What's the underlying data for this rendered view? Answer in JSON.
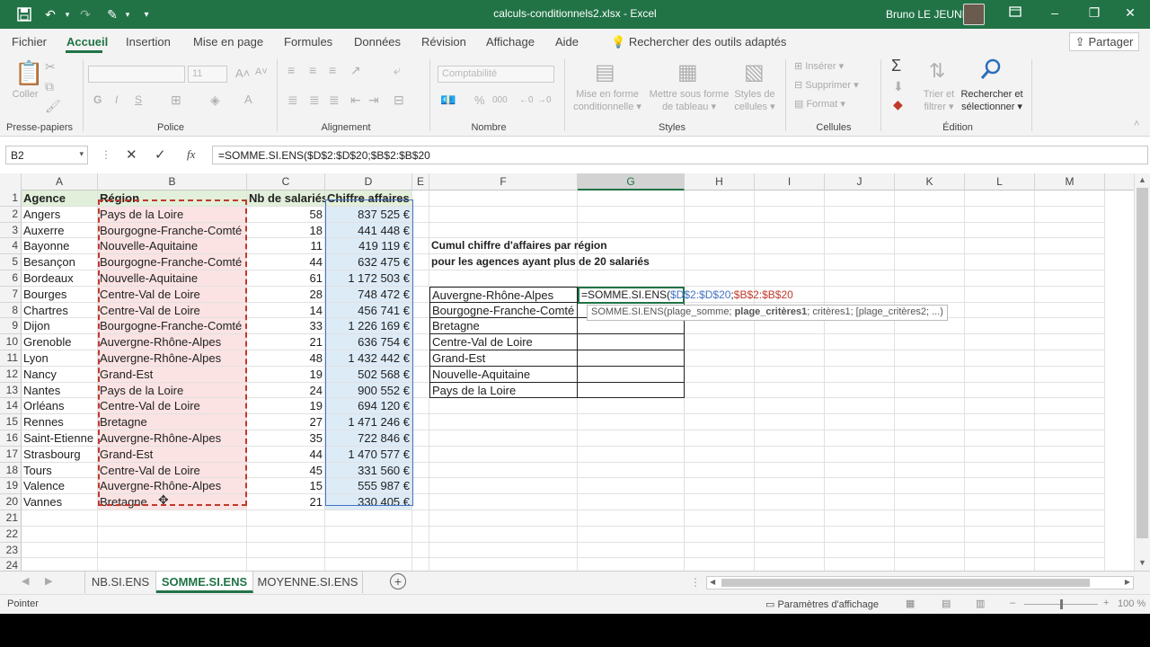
{
  "title": {
    "document": "calculs-conditionnels2.xlsx  -  Excel",
    "user": "Bruno LE JEUNE"
  },
  "tabs": [
    "Fichier",
    "Accueil",
    "Insertion",
    "Mise en page",
    "Formules",
    "Données",
    "Révision",
    "Affichage",
    "Aide"
  ],
  "tell_me": "Rechercher des outils adaptés",
  "share": "Partager",
  "ribbon": {
    "clipboard": {
      "paste": "Coller",
      "group": "Presse-papiers"
    },
    "font": {
      "group": "Police",
      "size": "11"
    },
    "alignment": {
      "group": "Alignement"
    },
    "number": {
      "group": "Nombre",
      "format": "Comptabilité",
      "percent": "%",
      "thousands": "000"
    },
    "styles": {
      "group": "Styles",
      "cond1": "Mise en forme",
      "cond2": "conditionnelle",
      "table1": "Mettre sous forme",
      "table2": "de tableau",
      "cell1": "Styles de",
      "cell2": "cellules"
    },
    "cells": {
      "group": "Cellules",
      "insert": "Insérer",
      "delete": "Supprimer",
      "format": "Format"
    },
    "editing": {
      "group": "Édition",
      "sort1": "Trier et",
      "sort2": "filtrer",
      "find1": "Rechercher et",
      "find2": "sélectionner"
    }
  },
  "formula_bar": {
    "name_box": "B2",
    "formula": "=SOMME.SI.ENS($D$2:$D$20;$B$2:$B$20"
  },
  "columns": [
    "A",
    "B",
    "C",
    "D",
    "E",
    "F",
    "G",
    "H",
    "I",
    "J",
    "K",
    "L",
    "M"
  ],
  "headers": {
    "a": "Agence",
    "b": "Région",
    "c": "Nb de salariés",
    "d": "Chiffre affaires"
  },
  "rows": [
    {
      "n": "1"
    },
    {
      "n": "2",
      "a": "Angers",
      "b": "Pays de la Loire",
      "c": "58",
      "d": "837 525 €"
    },
    {
      "n": "3",
      "a": "Auxerre",
      "b": "Bourgogne-Franche-Comté",
      "c": "18",
      "d": "441 448 €"
    },
    {
      "n": "4",
      "a": "Bayonne",
      "b": "Nouvelle-Aquitaine",
      "c": "11",
      "d": "419 119 €"
    },
    {
      "n": "5",
      "a": "Besançon",
      "b": "Bourgogne-Franche-Comté",
      "c": "44",
      "d": "632 475 €"
    },
    {
      "n": "6",
      "a": "Bordeaux",
      "b": "Nouvelle-Aquitaine",
      "c": "61",
      "d": "1 172 503 €"
    },
    {
      "n": "7",
      "a": "Bourges",
      "b": "Centre-Val de Loire",
      "c": "28",
      "d": "748 472 €"
    },
    {
      "n": "8",
      "a": "Chartres",
      "b": "Centre-Val de Loire",
      "c": "14",
      "d": "456 741 €"
    },
    {
      "n": "9",
      "a": "Dijon",
      "b": "Bourgogne-Franche-Comté",
      "c": "33",
      "d": "1 226 169 €"
    },
    {
      "n": "10",
      "a": "Grenoble",
      "b": "Auvergne-Rhône-Alpes",
      "c": "21",
      "d": "636 754 €"
    },
    {
      "n": "11",
      "a": "Lyon",
      "b": "Auvergne-Rhône-Alpes",
      "c": "48",
      "d": "1 432 442 €"
    },
    {
      "n": "12",
      "a": "Nancy",
      "b": "Grand-Est",
      "c": "19",
      "d": "502 568 €"
    },
    {
      "n": "13",
      "a": "Nantes",
      "b": "Pays de la Loire",
      "c": "24",
      "d": "900 552 €"
    },
    {
      "n": "14",
      "a": "Orléans",
      "b": "Centre-Val de Loire",
      "c": "19",
      "d": "694 120 €"
    },
    {
      "n": "15",
      "a": "Rennes",
      "b": "Bretagne",
      "c": "27",
      "d": "1 471 246 €"
    },
    {
      "n": "16",
      "a": "Saint-Etienne",
      "b": "Auvergne-Rhône-Alpes",
      "c": "35",
      "d": "722 846 €"
    },
    {
      "n": "17",
      "a": "Strasbourg",
      "b": "Grand-Est",
      "c": "44",
      "d": "1 470 577 €"
    },
    {
      "n": "18",
      "a": "Tours",
      "b": "Centre-Val de Loire",
      "c": "45",
      "d": "331 560 €"
    },
    {
      "n": "19",
      "a": "Valence",
      "b": "Auvergne-Rhône-Alpes",
      "c": "15",
      "d": "555 987 €"
    },
    {
      "n": "20",
      "a": "Vannes",
      "b": "Bretagne",
      "c": "21",
      "d": "330 405 €"
    },
    {
      "n": "21"
    },
    {
      "n": "22"
    },
    {
      "n": "23"
    },
    {
      "n": "24"
    }
  ],
  "summary": {
    "title1": "Cumul chiffre d'affaires par région",
    "title2": "pour les agences ayant plus de 20 salariés",
    "regions": [
      "Auvergne-Rhône-Alpes",
      "Bourgogne-Franche-Comté",
      "Bretagne",
      "Centre-Val de Loire",
      "Grand-Est",
      "Nouvelle-Aquitaine",
      "Pays de la Loire"
    ]
  },
  "edit": {
    "f1": "=SOMME.SI.ENS(",
    "f2": "$D$2:$D$20",
    "f3": ";",
    "f4": "$B$2:$B$20",
    "tip1": "SOMME.SI.ENS(plage_somme; ",
    "tip2": "plage_critères1",
    "tip3": "; critères1; [plage_critères2; ...)"
  },
  "sheets": [
    "NB.SI.ENS",
    "SOMME.SI.ENS",
    "MOYENNE.SI.ENS"
  ],
  "status": {
    "mode": "Pointer",
    "display": "Paramètres d'affichage",
    "zoom": "100 %"
  },
  "colors": {
    "accent": "#217346",
    "ref_d": "#4472c4",
    "ref_b": "#c0392b"
  }
}
